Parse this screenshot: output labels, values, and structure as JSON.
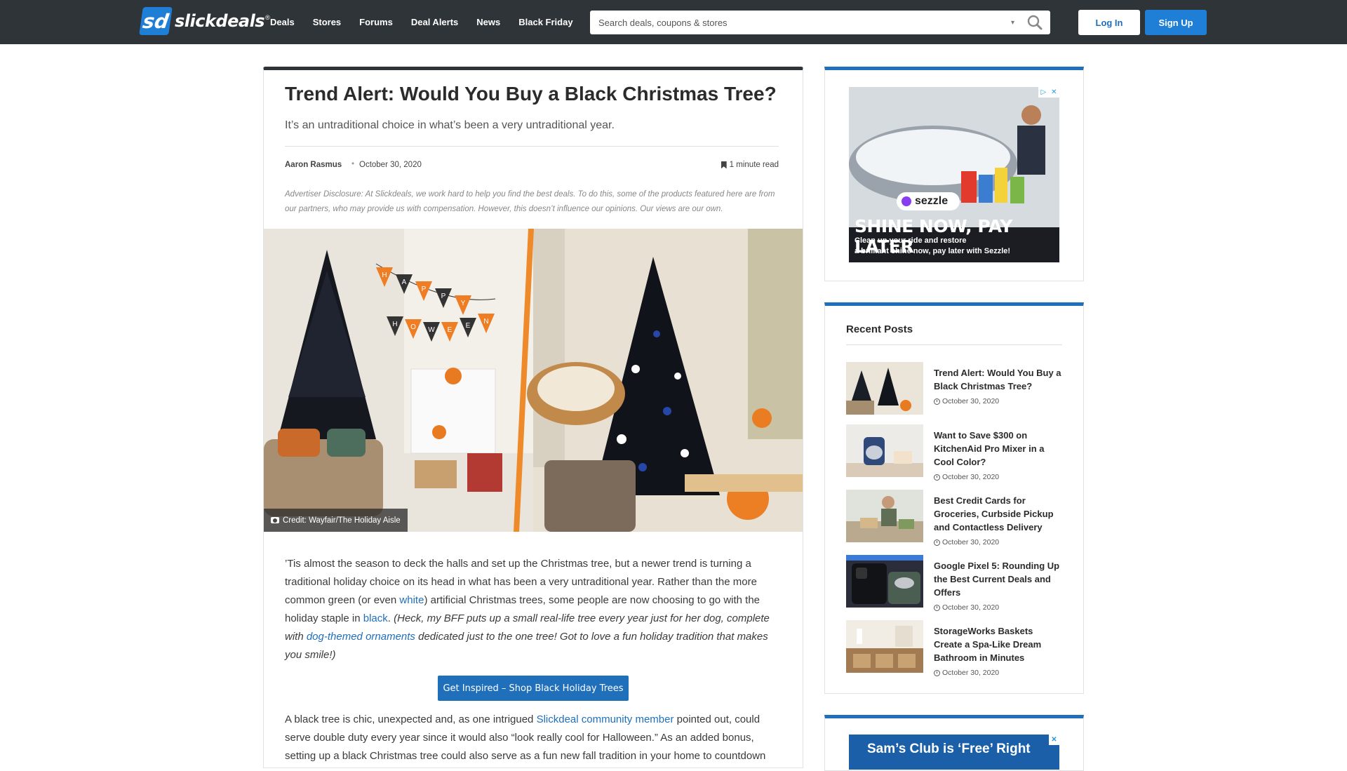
{
  "header": {
    "logo_mark": "sd",
    "logo_text": "slickdeals",
    "logo_reg": "®",
    "nav": [
      "Deals",
      "Stores",
      "Forums",
      "Deal Alerts",
      "News",
      "Black Friday"
    ],
    "search_placeholder": "Search deals, coupons & stores",
    "login_label": "Log In",
    "signup_label": "Sign Up"
  },
  "article": {
    "title": "Trend Alert: Would You Buy a Black Christmas Tree?",
    "subtitle": "It’s an untraditional choice in what’s been a very untraditional year.",
    "author": "Aaron Rasmus",
    "separator": "•",
    "date": "October 30, 2020",
    "read_time": "1 minute read",
    "disclosure": "Advertiser Disclosure: At Slickdeals, we work hard to help you find the best deals. To do this, some of the products featured here are from our partners, who may provide us with compensation. However, this doesn’t influence our opinions. Our views are our own.",
    "image_credit": "Credit: Wayfair/The Holiday Aisle",
    "hero_banner_letters": [
      "H",
      "A",
      "P",
      "P",
      "Y",
      "H",
      "O",
      "W",
      "E",
      "E",
      "N"
    ],
    "p1": {
      "t1": "’Tis almost the season to deck the halls and set up the Christmas tree, but a newer trend is turning a traditional holiday choice on its head in what has been a very untraditional year. Rather than the more common green (or even ",
      "link_white": "white",
      "t2": ") artificial Christmas trees, some people are now choosing to go with the holiday staple in ",
      "link_black": "black",
      "t3": ". ",
      "i1": "(Heck, my BFF puts up a small real-life tree every year just for her dog, complete with ",
      "link_dog": "dog-themed ornaments",
      "i2": " dedicated just to the one tree! Got to love a fun holiday tradition that makes you smile!)"
    },
    "cta_label": "Get Inspired – Shop Black Holiday Trees",
    "p2": {
      "t1": "A black tree is chic, unexpected and, as one intrigued ",
      "link_member": "Slickdeal community member",
      "t2": " pointed out, could serve double duty every year since it would also “look really cool for Halloween.” As an added bonus, setting up a black Christmas tree could also serve as a fun new fall tradition in your home to countdown"
    }
  },
  "sidebar": {
    "ad1": {
      "brand_badge": "sezzle",
      "headline": "SHINE NOW, PAY LATER",
      "line1": "Clean up your ride and restore",
      "line2": "a brilliant shine now, pay later with Sezzle!"
    },
    "recent_title": "Recent Posts",
    "posts": [
      {
        "title": "Trend Alert: Would You Buy a Black Christmas Tree?",
        "date": "October 30, 2020"
      },
      {
        "title": "Want to Save $300 on KitchenAid Pro Mixer in a Cool Color?",
        "date": "October 30, 2020"
      },
      {
        "title": "Best Credit Cards for Groceries, Curbside Pickup and Contactless Delivery",
        "date": "October 30, 2020"
      },
      {
        "title": "Google Pixel 5: Rounding Up the Best Current Deals and Offers",
        "date": "October 30, 2020"
      },
      {
        "title": "StorageWorks Baskets Create a Spa-Like Dream Bathroom in Minutes",
        "date": "October 30, 2020"
      }
    ],
    "ad2_text": "Sam’s Club is ‘Free’ Right"
  },
  "colors": {
    "topbar": "#2f3438",
    "brand_blue": "#1f7ed6",
    "link_blue": "#1f6fba",
    "sidebar_accent": "#1f6fba"
  }
}
